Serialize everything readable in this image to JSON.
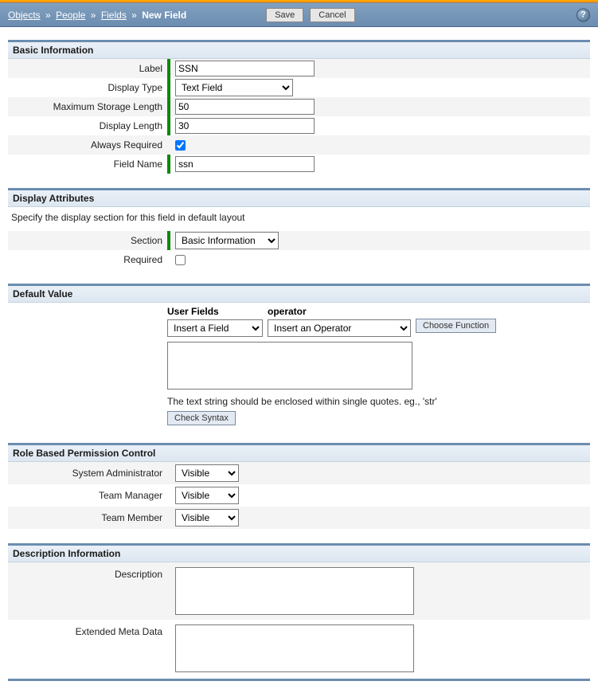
{
  "breadcrumbs": {
    "objects": "Objects",
    "people": "People",
    "fields": "Fields",
    "current": "New Field"
  },
  "header": {
    "save": "Save",
    "cancel": "Cancel"
  },
  "sections": {
    "basic": {
      "title": "Basic Information",
      "label_l": "Label",
      "label_v": "SSN",
      "dtype_l": "Display Type",
      "dtype_v": "Text Field",
      "maxlen_l": "Maximum Storage Length",
      "maxlen_v": "50",
      "dlen_l": "Display Length",
      "dlen_v": "30",
      "areq_l": "Always Required",
      "fname_l": "Field Name",
      "fname_v": "ssn"
    },
    "display": {
      "title": "Display Attributes",
      "desc": "Specify the display section for this field in default layout",
      "section_l": "Section",
      "section_v": "Basic Information",
      "required_l": "Required"
    },
    "defval": {
      "title": "Default Value",
      "userfields_l": "User Fields",
      "userfields_v": "Insert a Field",
      "operator_l": "operator",
      "operator_v": "Insert an Operator",
      "choosefunc": "Choose Function",
      "hint": "The text string should be enclosed within single quotes. eg., 'str'",
      "checksyntax": "Check Syntax"
    },
    "roles": {
      "title": "Role Based Permission Control",
      "sysadmin_l": "System Administrator",
      "teammgr_l": "Team Manager",
      "teammem_l": "Team Member",
      "visible": "Visible"
    },
    "descinfo": {
      "title": "Description Information",
      "desc_l": "Description",
      "ext_l": "Extended Meta Data"
    }
  }
}
